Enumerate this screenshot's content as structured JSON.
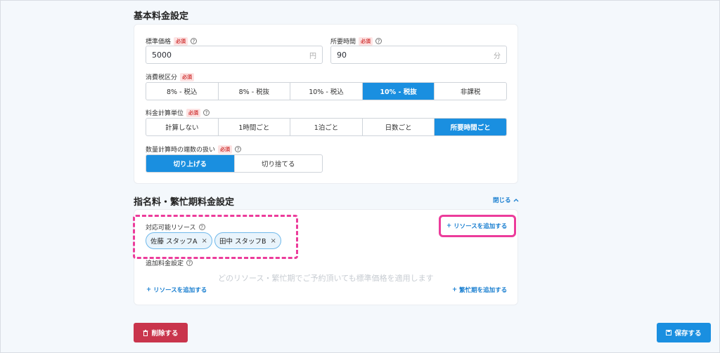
{
  "basic_section": {
    "title": "基本料金設定",
    "standard_price": {
      "label": "標準価格",
      "required": "必須",
      "value": "5000",
      "unit": "円"
    },
    "duration": {
      "label": "所要時間",
      "required": "必須",
      "value": "90",
      "unit": "分"
    },
    "tax": {
      "label": "消費税区分",
      "required": "必須",
      "options": [
        "8% - 税込",
        "8% - 税抜",
        "10% - 税込",
        "10% - 税抜",
        "非課税"
      ],
      "selected": "10% - 税抜"
    },
    "calc_unit": {
      "label": "料金計算単位",
      "required": "必須",
      "options": [
        "計算しない",
        "1時間ごと",
        "1泊ごと",
        "日数ごと",
        "所要時間ごと"
      ],
      "selected": "所要時間ごと"
    },
    "rounding": {
      "label": "数量計算時の端数の扱い",
      "required": "必須",
      "options": [
        "切り上げる",
        "切り捨てる"
      ],
      "selected": "切り上げる"
    }
  },
  "nomination_section": {
    "title": "指名料・繁忙期料金設定",
    "close_label": "閉じる",
    "resources": {
      "label": "対応可能リソース",
      "add_label": "リソースを追加する",
      "chips": [
        "佐藤 スタッフA",
        "田中 スタッフB"
      ]
    },
    "extra_fee": {
      "label": "追加料金設定",
      "empty_message": "どのリソース・繁忙期でご予約頂いても標準価格を適用します",
      "add_resource_label": "リソースを追加する",
      "add_busy_label": "繁忙期を追加する"
    }
  },
  "footer": {
    "delete_label": "削除する",
    "save_label": "保存する"
  },
  "colors": {
    "accent": "#1a8fe0",
    "danger": "#c9354c",
    "highlight": "#ec3c9b"
  }
}
